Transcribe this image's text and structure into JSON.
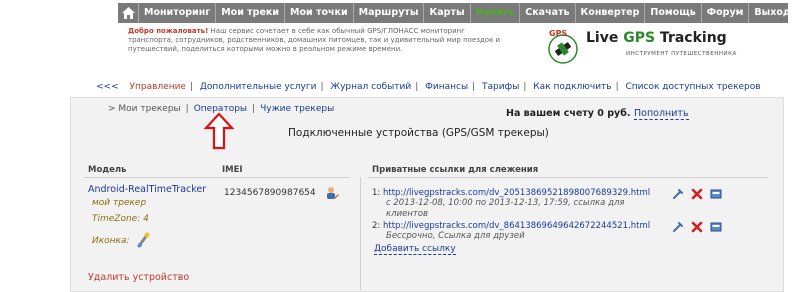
{
  "top_nav": {
    "items": [
      "Мониторинг",
      "Мои треки",
      "Мои точки",
      "Маршруты",
      "Карты",
      "Купить",
      "Скачать",
      "Конвертер",
      "Помощь",
      "Форум",
      "Выход"
    ]
  },
  "banner": {
    "welcome_bold": "Добро пожаловать!",
    "welcome_text": " Наш сервис сочетает в себе как обычный GPS/ГЛОНАСС мониторинг транспорта, сотрудников, родственников, домашних питомцев, так и удивительный мир поездок и путешествий, поделиться которыми можно в реальном режиме времени.",
    "logo_title_a": "Live ",
    "logo_title_b": "GPS",
    "logo_title_c": " Tracking",
    "logo_subtitle": "ИНСТРУМЕНТ ПУТЕШЕСТВЕННИКА",
    "logo_badge": "GPS"
  },
  "sub_nav": {
    "back": "<<<",
    "items": [
      "Управление",
      "Дополнительные услуги",
      "Журнал событий",
      "Финансы",
      "Тарифы",
      "Как подключить",
      "Список доступных трекеров"
    ]
  },
  "tabs": {
    "prefix": "> Мои трекеры",
    "operators": "Операторы",
    "foreign": "Чужие трекеры"
  },
  "account": {
    "balance": "На вашем счету 0 руб.",
    "topup": "Пополнить"
  },
  "connected_title": "Подключенные устройства (GPS/GSM трекеры)",
  "table": {
    "col_model": "Модель",
    "col_imei": "IMEI",
    "col_links": "Приватные ссылки для слежения"
  },
  "device": {
    "name": "Android-RealTimeTracker",
    "imei": "1234567890987654",
    "label": "мой трекер",
    "timezone": "TimeZone: 4",
    "icon_label": "Иконка:",
    "delete": "Удалить устройство"
  },
  "links": [
    {
      "num": "1:",
      "url": "http://livegpstracks.com/dv_20513869521898007689329.html",
      "desc_a": "с 2013-12-08, 10:00 по 2013-12-13, 17:59, ссылка для",
      "desc_b": "клиентов"
    },
    {
      "num": "2:",
      "url": "http://livegpstracks.com/dv_86413869649642672244521.html",
      "desc_a": "Бессрочно, Ссылка для друзей",
      "desc_b": ""
    }
  ],
  "add_link": "Добавить ссылку",
  "colors": {
    "nav_bg": "#7a7a7a",
    "nav_active": "#4caf24",
    "link": "#1a3a9a",
    "red": "#c0392b",
    "italic_note": "#8a6d10"
  }
}
